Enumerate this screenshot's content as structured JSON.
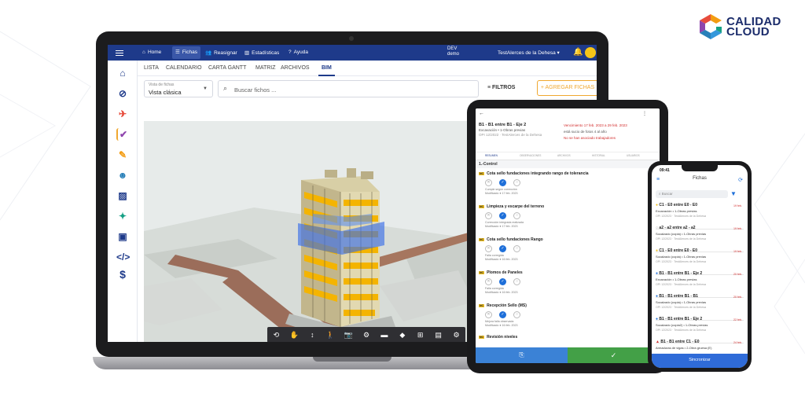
{
  "brand": {
    "line1": "CALIDAD",
    "line2": "CLOUD",
    "colors": [
      "#f39c12",
      "#e74c3c",
      "#8e44ad",
      "#2980b9"
    ]
  },
  "laptop": {
    "nav": {
      "items": [
        {
          "icon": "home-icon",
          "label": "Home"
        },
        {
          "icon": "list-icon",
          "label": "Fichas"
        },
        {
          "icon": "users-icon",
          "label": "Reasignar"
        },
        {
          "icon": "chart-icon",
          "label": "Estadísticas"
        },
        {
          "icon": "help-icon",
          "label": "Ayuda"
        }
      ],
      "env": [
        "DEV",
        "demo"
      ],
      "project": "TestAlerces de la Dehesa"
    },
    "tabs": [
      "LISTA",
      "CALENDARIO",
      "CARTA GANTT",
      "MATRIZ",
      "ARCHIVOS",
      "BIM"
    ],
    "active_tab": "BIM",
    "view_select": {
      "label": "Vista de fichas",
      "value": "Vista clásica"
    },
    "search_placeholder": "Buscar fichos ...",
    "filters_label": "FILTROS",
    "add_button": "+ AGREGAR FICHAS",
    "colors": {
      "navbar": "#1e3a8a",
      "accent": "#f0a830"
    }
  },
  "tablet": {
    "ficha_title": "B1 - B1 entre B1 - Eje 2",
    "ficha_sub1": "Excavación • 1-Obras previas",
    "ficha_sub2": "OPI 12/2022 · TestAlerces de la Dehesa",
    "due": "Vencimiento 17 feb. 2023 a 29 feb. 2023",
    "meta1": "está sucio de fotos 4 al año",
    "meta2": "No se han asociado trabajadores",
    "tab_labels": [
      "RESUMEN",
      "OBSERVACIONES",
      "ARCHIVOS",
      "HISTORIAL",
      "USUARIOS"
    ],
    "section": "1.-Control",
    "items": [
      {
        "title": "Cota sello fundaciones integrando rango de tolerancia",
        "note": "Cumple según corrección",
        "date": "Modificado ● 17 feb. 2023"
      },
      {
        "title": "Limpieza y escarpe del terreno",
        "note": "Corrección integrada realizada",
        "date": "Modificado ● 17 feb. 2023"
      },
      {
        "title": "Cota sello fundaciones Rango",
        "note": "Falla corregida",
        "date": "Modificado ● 16 feb. 2023"
      },
      {
        "title": "Plomos de Paneles",
        "note": "Falla corregida",
        "date": "Modificado ● 16 feb. 2023"
      },
      {
        "title": "Recepción Sello (MS)",
        "note": "Mejora falla observada",
        "date": "Modificado ● 16 feb. 2023"
      },
      {
        "title": "Revisión niveles",
        "note": "",
        "date": ""
      }
    ],
    "bottom_left": "⎘",
    "bottom_right": "✓"
  },
  "phone": {
    "time": "09:41",
    "header": "Fichas",
    "search_placeholder": "Buscar",
    "cards": [
      {
        "title": "C1 - E0 entre E0 - E0",
        "sub": "Excavación • 1-Obras previas",
        "meta": "OPI 12/2023 · TestAlerces de la Dehesa",
        "date": "19 feb.",
        "dot": "#f0c020"
      },
      {
        "title": "a2 - a2 entre a2 - a2",
        "sub": "Socalzado (copia) • 1-Obras previas",
        "meta": "OPI 12/2023 · TestAlerces de la Dehesa",
        "date": "19 feb.",
        "dot": "#9e9e9e"
      },
      {
        "title": "C1 - E0 entre E0 - E0",
        "sub": "Socalzado (copia) • 1-Obras previas",
        "meta": "OPI 12/2023 · TestAlerces de la Dehesa",
        "date": "19 feb.",
        "dot": "#f0c020"
      },
      {
        "title": "B1 - B1 entre B1 - Eje 2",
        "sub": "Excavación • 1-Obras previas",
        "meta": "OPI 12/2023 · TestAlerces de la Dehesa",
        "date": "20 feb.",
        "dot": "#1e6fd9"
      },
      {
        "title": "B1 - B1 entre B1 - B1",
        "sub": "Socalzado (copia) • 1-Obras previas",
        "meta": "OPI 12/2023 · TestAlerces de la Dehesa",
        "date": "20 feb.",
        "dot": "#1e6fd9"
      },
      {
        "title": "B1 - B1 entre B1 - Eje 2",
        "sub": "Socalzado (copia2) • 1-Obras previas",
        "meta": "OPI 12/2023 · TestAlerces de la Dehesa",
        "date": "22 feb.",
        "dot": "#1e6fd9"
      },
      {
        "title": "B1 - B1 entre C1 - E0",
        "sub": "Armaduras de vigas • 2-Obra gruesa (E)",
        "meta": "",
        "date": "24 feb.",
        "dot": "#d32f2f"
      }
    ],
    "sync_button": "Sincronizar"
  }
}
